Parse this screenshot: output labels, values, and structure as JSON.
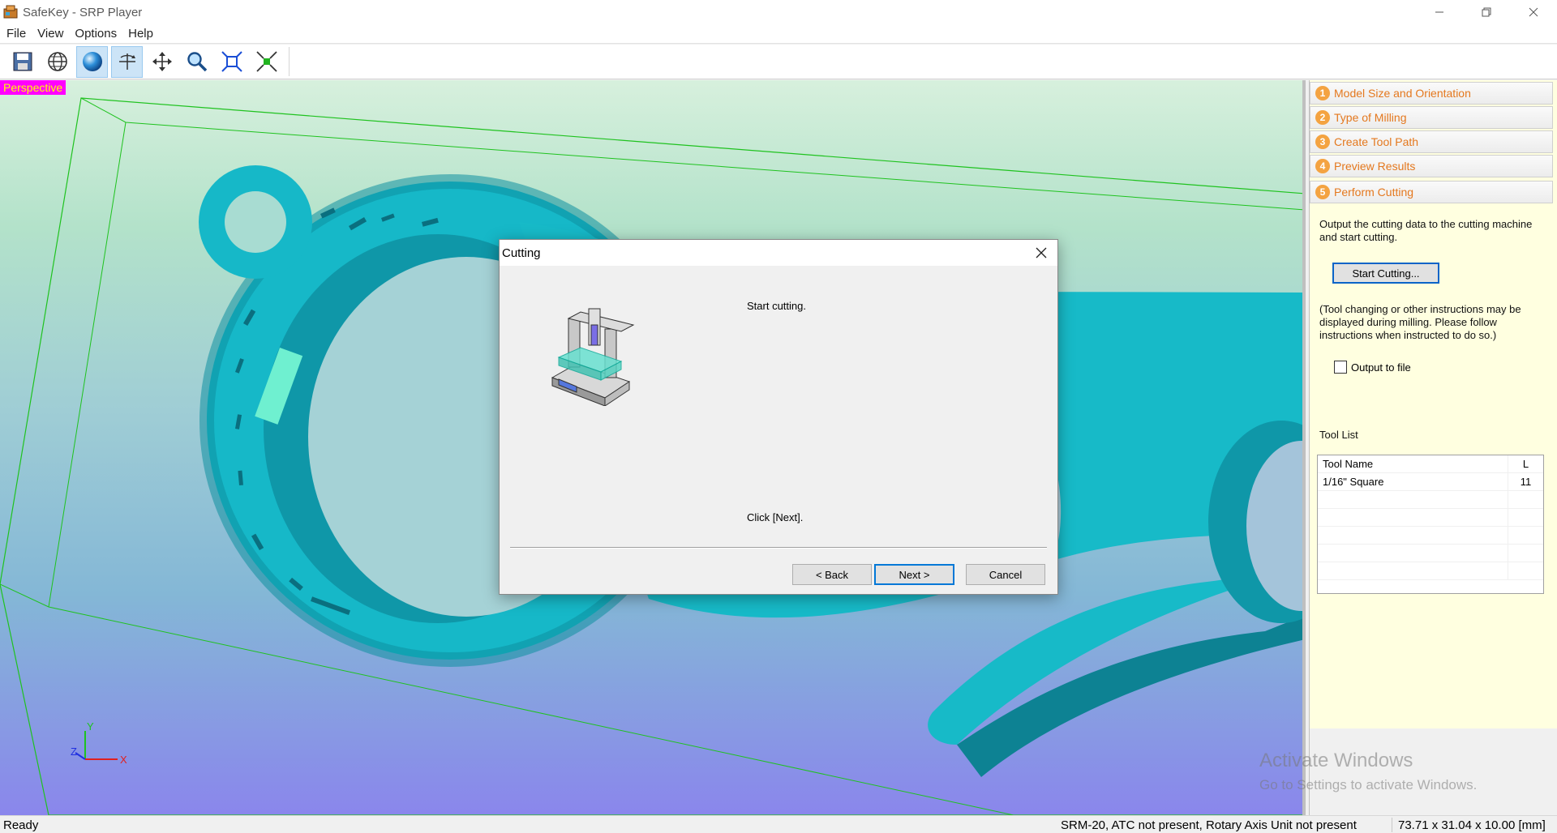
{
  "window": {
    "title": "SafeKey - SRP Player",
    "controls": [
      "minimize-icon",
      "restore-icon",
      "close-icon"
    ]
  },
  "menu": [
    "File",
    "View",
    "Options",
    "Help"
  ],
  "toolbar": {
    "buttons": [
      "save-icon",
      "wireframe-globe-icon",
      "solid-sphere-icon",
      "rotate-icon",
      "pan-icon",
      "zoom-icon",
      "fit-view-icon",
      "origin-icon"
    ],
    "active": [
      "solid-sphere-icon",
      "rotate-icon"
    ]
  },
  "viewport": {
    "view_label": "Perspective",
    "axes": {
      "y": "Y",
      "z": "Z",
      "x": "X"
    }
  },
  "panel": {
    "steps": [
      {
        "num": "1",
        "label": "Model Size and Orientation"
      },
      {
        "num": "2",
        "label": "Type of Milling"
      },
      {
        "num": "3",
        "label": "Create Tool Path"
      },
      {
        "num": "4",
        "label": "Preview Results"
      },
      {
        "num": "5",
        "label": "Perform Cutting"
      }
    ],
    "description": "Output the cutting data to the cutting machine and start cutting.",
    "start_button": "Start Cutting...",
    "note": "(Tool changing or other instructions may be displayed during milling. Please follow instructions when instructed to do so.)",
    "output_to_file": "Output to file",
    "tool_list_label": "Tool List",
    "tool_table": {
      "headers": [
        "Tool Name",
        "L"
      ],
      "rows": [
        {
          "name": "1/16\" Square",
          "l": "11"
        }
      ]
    }
  },
  "watermark": {
    "line1": "Activate Windows",
    "line2": "Go to Settings to activate Windows."
  },
  "status": {
    "ready": "Ready",
    "machine": "SRM-20, ATC not present, Rotary Axis Unit not present",
    "size": "73.71 x  31.04 x  10.00 [mm]"
  },
  "dialog": {
    "title": "Cutting",
    "message1": "Start cutting.",
    "message2": "Click [Next].",
    "back": "< Back",
    "next": "Next >",
    "cancel": "Cancel"
  }
}
